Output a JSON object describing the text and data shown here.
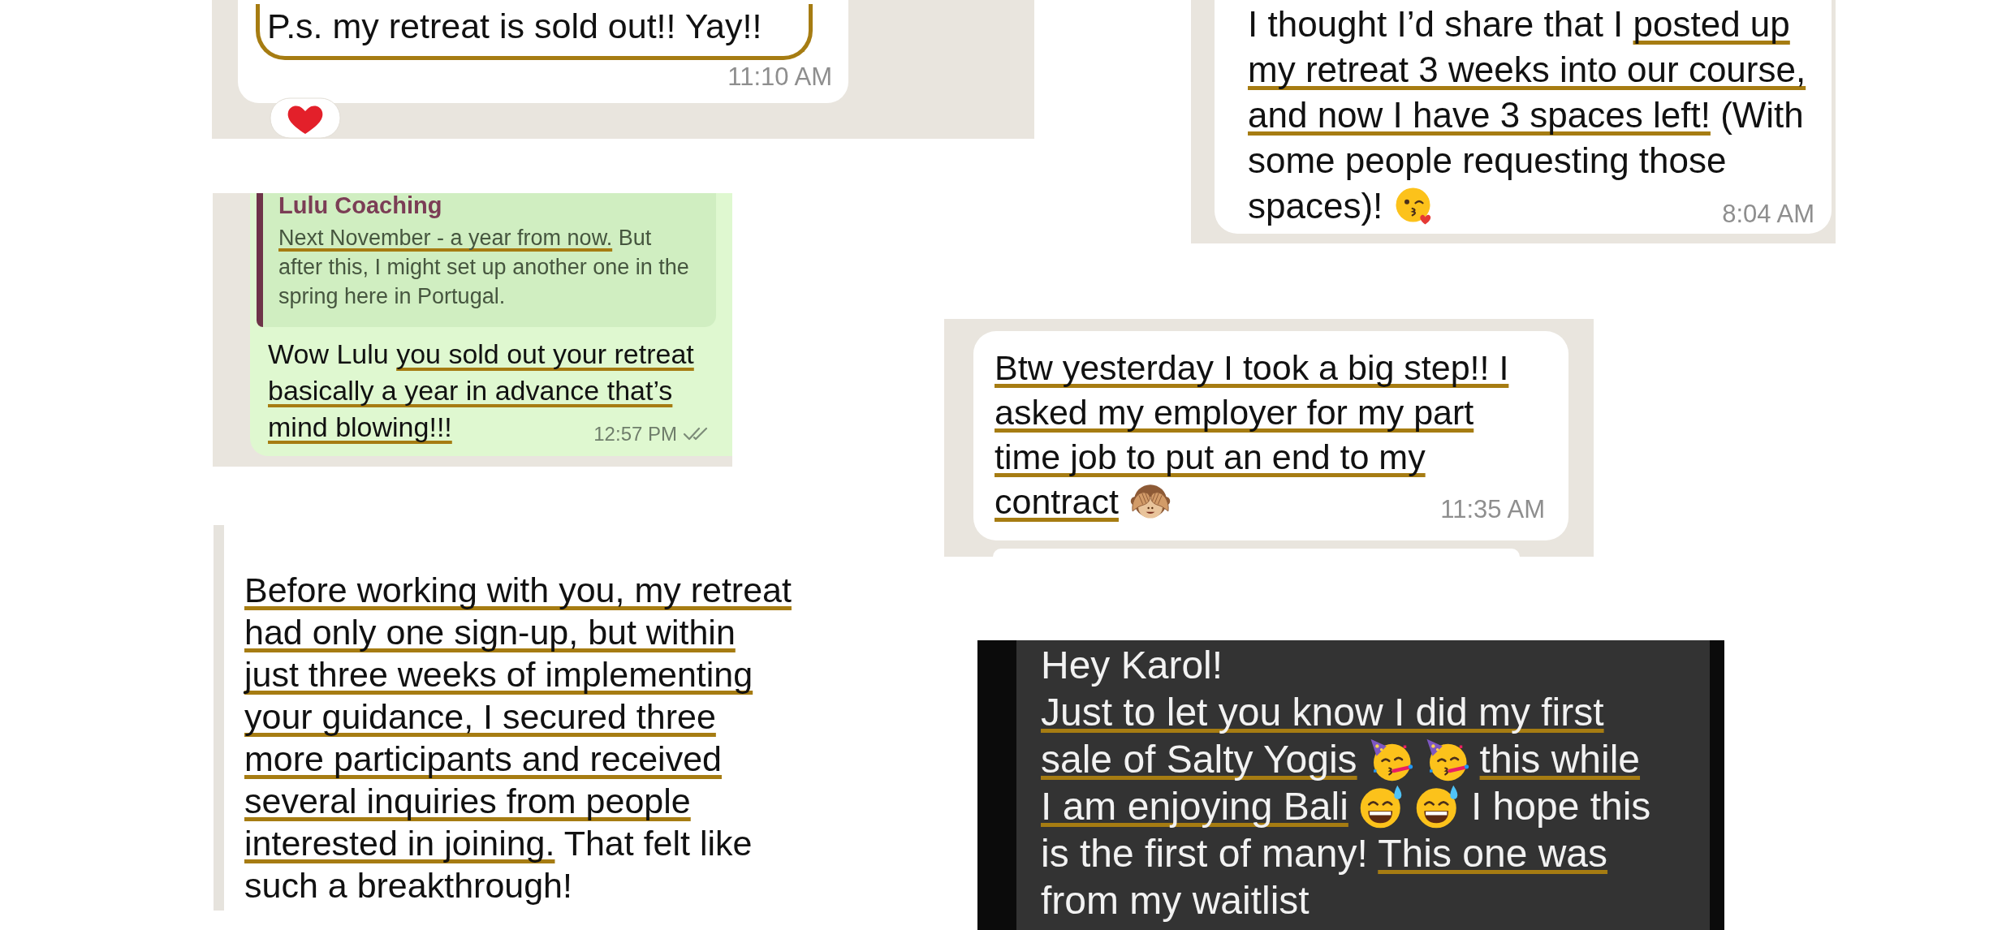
{
  "messages": [
    {
      "kind": "incoming",
      "circled": true,
      "lines": [
        [
          {
            "kind": "text",
            "text": "P.s. my retreat is sold out!! Yay!!",
            "underlined": false
          }
        ]
      ],
      "time": "11:10 AM",
      "reaction": {
        "kind": "heart"
      }
    },
    {
      "kind": "incoming",
      "lines": [
        [
          {
            "kind": "text",
            "text": "I thought I’d share that I ",
            "underlined": false
          },
          {
            "kind": "text",
            "text": "posted up",
            "underlined": true
          }
        ],
        [
          {
            "kind": "text",
            "text": "my retreat 3 weeks into our course,",
            "underlined": true
          }
        ],
        [
          {
            "kind": "text",
            "text": "and now I have 3 spaces left!",
            "underlined": true
          },
          {
            "kind": "text",
            "text": " (With",
            "underlined": false
          }
        ],
        [
          {
            "kind": "text",
            "text": "some people requesting those",
            "underlined": false
          }
        ],
        [
          {
            "kind": "text",
            "text": "spaces)!",
            "underlined": false
          },
          {
            "kind": "kiss"
          }
        ]
      ],
      "time": "8:04 AM"
    },
    {
      "kind": "outgoing",
      "quote": {
        "sender": "Lulu Coaching",
        "lines": [
          [
            {
              "kind": "text",
              "text": "Next November - a year from now.",
              "underlined": true
            },
            {
              "kind": "text",
              "text": " But",
              "underlined": false
            }
          ],
          [
            {
              "kind": "text",
              "text": "after this, I might set up another one in the",
              "underlined": false
            }
          ],
          [
            {
              "kind": "text",
              "text": "spring here in Portugal.",
              "underlined": false
            }
          ]
        ]
      },
      "lines": [
        [
          {
            "kind": "text",
            "text": "Wow Lulu ",
            "underlined": false
          },
          {
            "kind": "text",
            "text": "you sold out your retreat",
            "underlined": true
          }
        ],
        [
          {
            "kind": "text",
            "text": "basically a year in advance that’s",
            "underlined": true
          }
        ],
        [
          {
            "kind": "text",
            "text": "mind blowing!!!",
            "underlined": true
          }
        ]
      ],
      "time": "12:57 PM",
      "delivered": true
    },
    {
      "kind": "incoming",
      "lines": [
        [
          {
            "kind": "text",
            "text": "Btw yesterday I took a big step!! I",
            "underlined": true
          }
        ],
        [
          {
            "kind": "text",
            "text": "asked my employer for my part",
            "underlined": true
          }
        ],
        [
          {
            "kind": "text",
            "text": "time job to put an end to my",
            "underlined": true
          }
        ],
        [
          {
            "kind": "text",
            "text": "contract",
            "underlined": true
          },
          {
            "kind": "monkey"
          }
        ]
      ],
      "time": "11:35 AM",
      "following_bubble": true
    },
    {
      "kind": "plain",
      "lines": [
        [
          {
            "kind": "text",
            "text": "Before working with you, my retreat",
            "underlined": true
          }
        ],
        [
          {
            "kind": "text",
            "text": "had only one sign-up, but within",
            "underlined": true
          }
        ],
        [
          {
            "kind": "text",
            "text": "just three weeks of implementing",
            "underlined": true
          }
        ],
        [
          {
            "kind": "text",
            "text": "your guidance, I secured three",
            "underlined": true
          }
        ],
        [
          {
            "kind": "text",
            "text": "more participants and received",
            "underlined": true
          }
        ],
        [
          {
            "kind": "text",
            "text": "several inquiries from people",
            "underlined": true
          }
        ],
        [
          {
            "kind": "text",
            "text": "interested in joining.",
            "underlined": true
          },
          {
            "kind": "text",
            "text": " That felt like",
            "underlined": false
          }
        ],
        [
          {
            "kind": "text",
            "text": "such a breakthrough!",
            "underlined": false
          }
        ]
      ]
    },
    {
      "kind": "dark",
      "lines": [
        [
          {
            "kind": "text",
            "text": "Hey Karol!",
            "underlined": false
          }
        ],
        [
          {
            "kind": "text",
            "text": "Just to let you know I did my first",
            "underlined": true
          }
        ],
        [
          {
            "kind": "text",
            "text": "sale of Salty Yogis",
            "underlined": true
          },
          {
            "kind": "party"
          },
          {
            "kind": "party"
          },
          {
            "kind": "text",
            "text": "this while",
            "underlined": true
          }
        ],
        [
          {
            "kind": "text",
            "text": "I am enjoying Bali",
            "underlined": true
          },
          {
            "kind": "sweat"
          },
          {
            "kind": "sweat"
          },
          {
            "kind": "text",
            "text": "I hope this",
            "underlined": false
          }
        ],
        [
          {
            "kind": "text",
            "text": "is the first of many! ",
            "underlined": false
          },
          {
            "kind": "text",
            "text": "This one was",
            "underlined": true
          }
        ],
        [
          {
            "kind": "text",
            "text": "from my waitlist",
            "underlined": false
          }
        ]
      ]
    }
  ]
}
